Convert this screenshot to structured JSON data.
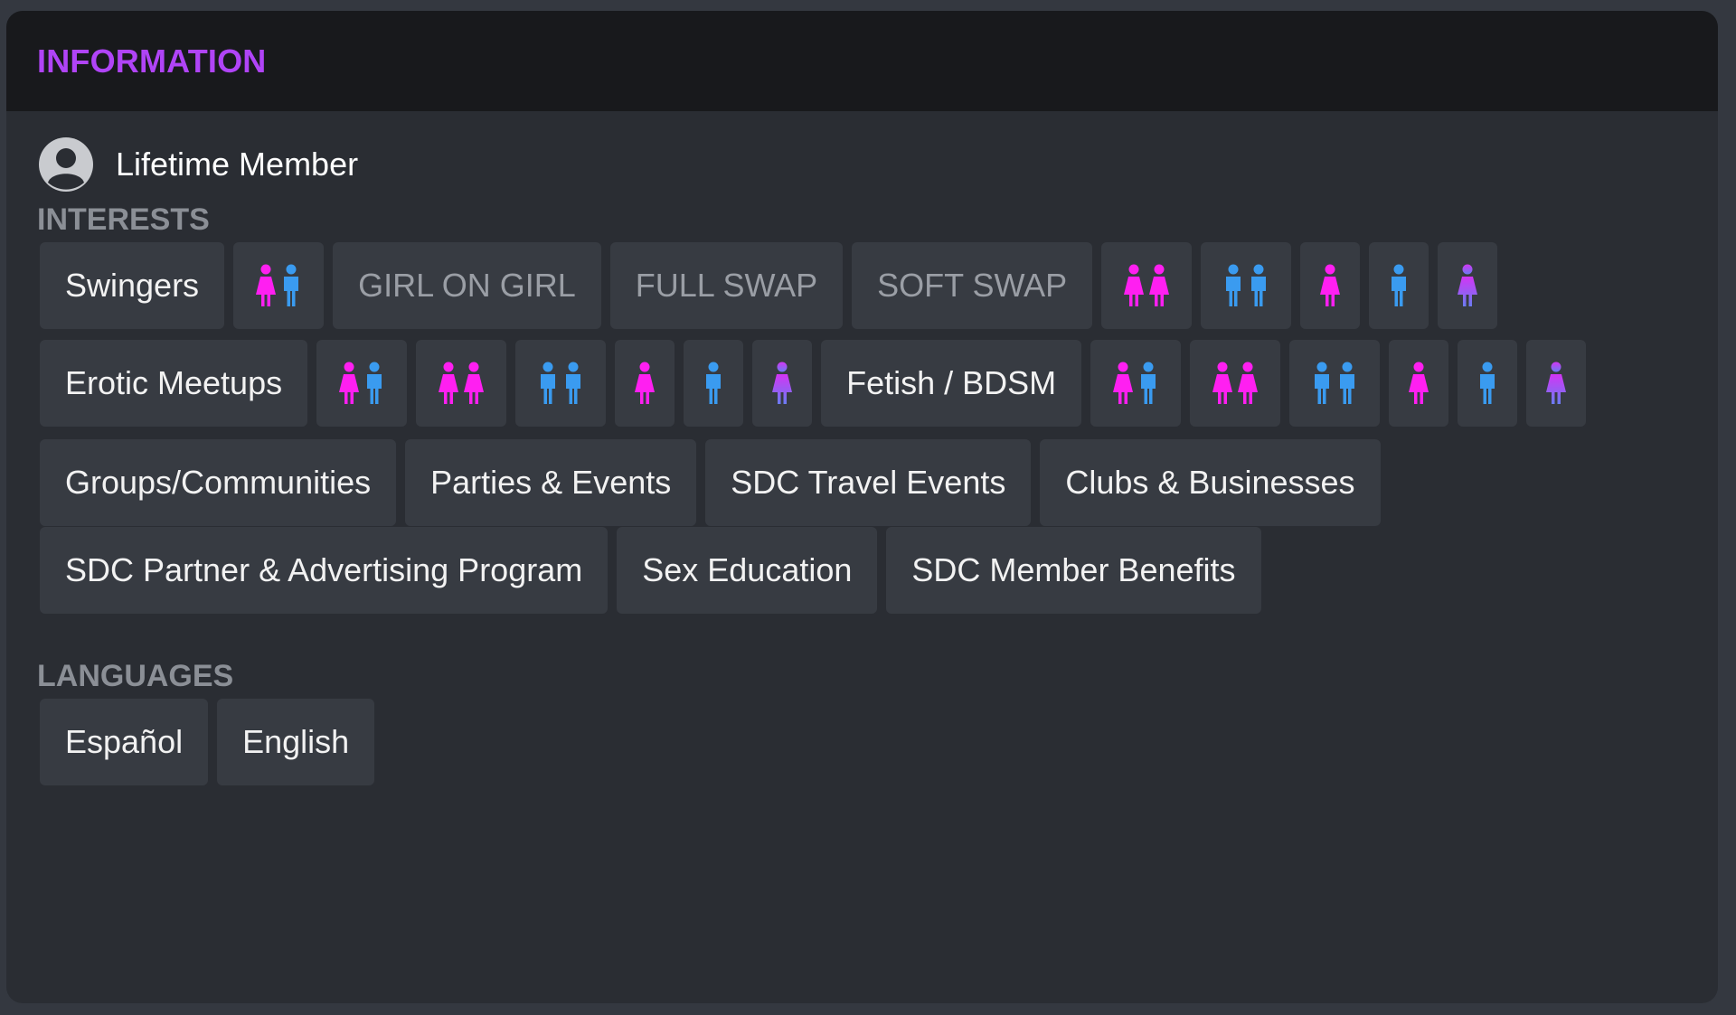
{
  "header": {
    "title": "INFORMATION"
  },
  "member": {
    "status": "Lifetime Member",
    "icon": "user-circle-icon"
  },
  "interests": {
    "label": "INTERESTS",
    "rows": [
      [
        {
          "type": "text",
          "label": "Swingers"
        },
        {
          "type": "icon",
          "icon": "couple-mf-icon"
        },
        {
          "type": "text",
          "label": "GIRL ON GIRL",
          "muted": true
        },
        {
          "type": "text",
          "label": "FULL SWAP",
          "muted": true
        },
        {
          "type": "text",
          "label": "SOFT SWAP",
          "muted": true
        },
        {
          "type": "icon",
          "icon": "couple-ff-icon"
        },
        {
          "type": "icon",
          "icon": "couple-mm-icon"
        },
        {
          "type": "icon",
          "icon": "female-icon"
        },
        {
          "type": "icon",
          "icon": "male-icon"
        },
        {
          "type": "icon",
          "icon": "trans-icon"
        }
      ],
      [
        {
          "type": "text",
          "label": "Erotic Meetups"
        },
        {
          "type": "icon",
          "icon": "couple-mf-icon"
        },
        {
          "type": "icon",
          "icon": "couple-ff-icon"
        },
        {
          "type": "icon",
          "icon": "couple-mm-icon"
        },
        {
          "type": "icon",
          "icon": "female-icon"
        },
        {
          "type": "icon",
          "icon": "male-icon"
        },
        {
          "type": "icon",
          "icon": "trans-icon"
        },
        {
          "type": "text",
          "label": "Fetish / BDSM"
        },
        {
          "type": "icon",
          "icon": "couple-mf-icon"
        },
        {
          "type": "icon",
          "icon": "couple-ff-icon"
        },
        {
          "type": "icon",
          "icon": "couple-mm-icon"
        },
        {
          "type": "icon",
          "icon": "female-icon"
        },
        {
          "type": "icon",
          "icon": "male-icon"
        },
        {
          "type": "icon",
          "icon": "trans-icon"
        }
      ],
      [
        {
          "type": "text",
          "label": "Groups/Communities"
        },
        {
          "type": "text",
          "label": "Parties & Events"
        },
        {
          "type": "text",
          "label": "SDC Travel Events"
        },
        {
          "type": "text",
          "label": "Clubs & Businesses"
        }
      ],
      [
        {
          "type": "text",
          "label": "SDC Partner & Advertising Program"
        },
        {
          "type": "text",
          "label": "Sex Education"
        },
        {
          "type": "text",
          "label": "SDC Member Benefits"
        }
      ]
    ]
  },
  "languages": {
    "label": "LANGUAGES",
    "items": [
      "Español",
      "English"
    ]
  },
  "colors": {
    "accent": "#b044f7",
    "female": "#ff1ff1",
    "male": "#3a9bf0",
    "trans_top": "#d235f4",
    "trans_bottom": "#6a7cf2"
  }
}
